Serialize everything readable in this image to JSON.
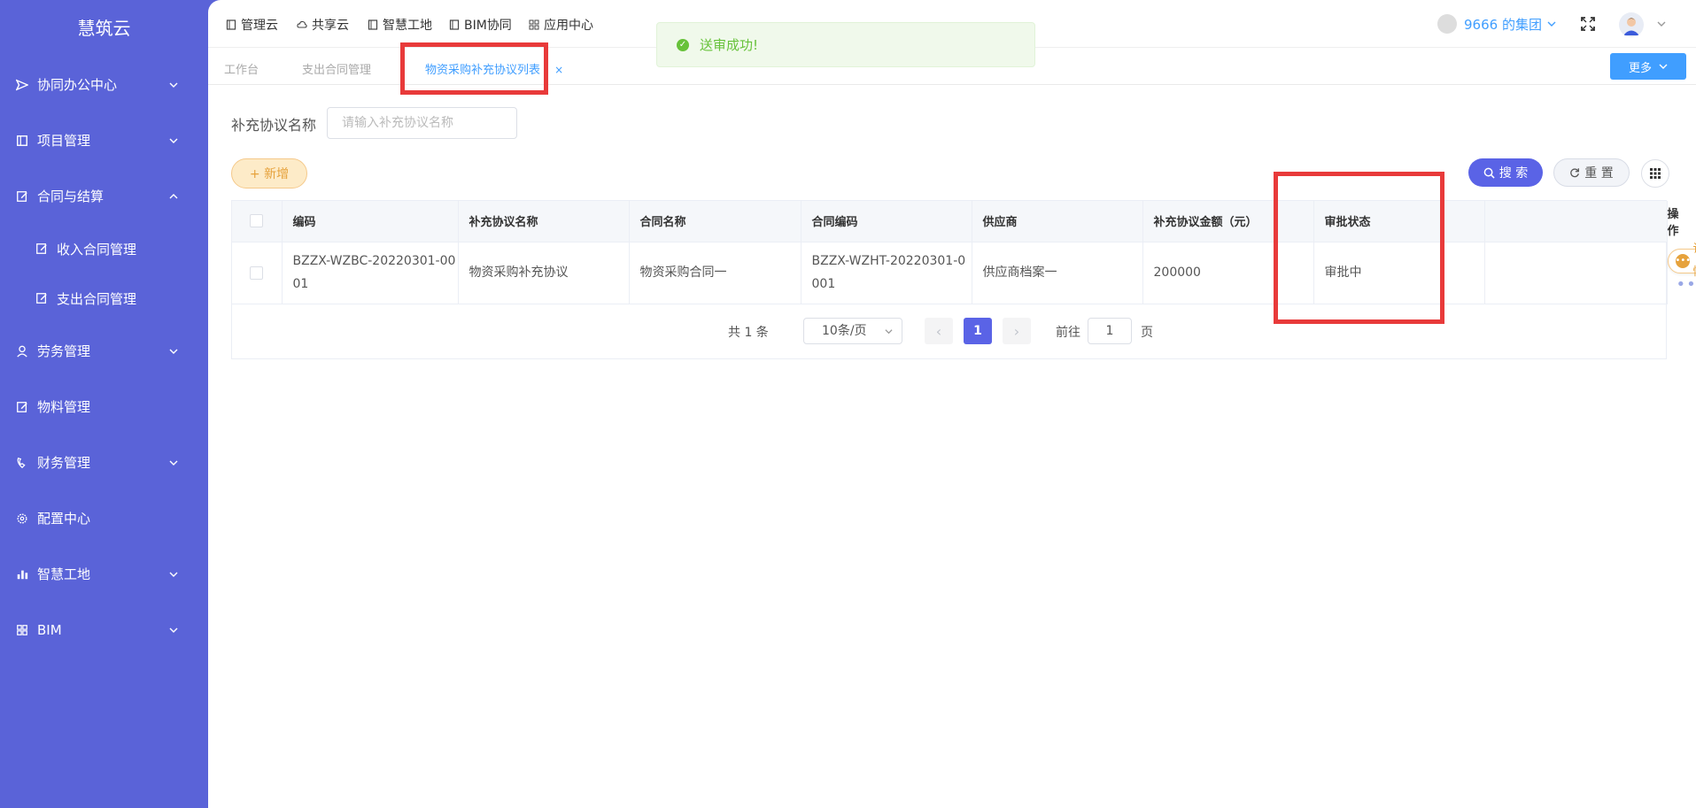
{
  "app": {
    "logo": "慧筑云"
  },
  "sidebar": {
    "items": [
      {
        "label": "协同办公中心",
        "icon": "send-icon",
        "expandable": true
      },
      {
        "label": "项目管理",
        "icon": "book-icon",
        "expandable": true
      },
      {
        "label": "合同与结算",
        "icon": "edit-icon",
        "expandable": true,
        "expanded": true,
        "children": [
          {
            "label": "收入合同管理",
            "icon": "edit-icon"
          },
          {
            "label": "支出合同管理",
            "icon": "edit-icon"
          }
        ]
      },
      {
        "label": "劳务管理",
        "icon": "worker-icon",
        "expandable": true
      },
      {
        "label": "物料管理",
        "icon": "edit-icon",
        "expandable": false
      },
      {
        "label": "财务管理",
        "icon": "phone-icon",
        "expandable": true
      },
      {
        "label": "配置中心",
        "icon": "gear-icon",
        "expandable": false
      },
      {
        "label": "智慧工地",
        "icon": "bar-chart-icon",
        "expandable": true
      },
      {
        "label": "BIM",
        "icon": "grid-icon",
        "expandable": true
      }
    ]
  },
  "topnav": {
    "items": [
      {
        "label": "管理云",
        "icon": "doc-icon"
      },
      {
        "label": "共享云",
        "icon": "cloud-icon"
      },
      {
        "label": "智慧工地",
        "icon": "doc-icon"
      },
      {
        "label": "BIM协同",
        "icon": "doc-icon"
      },
      {
        "label": "应用中心",
        "icon": "apps-icon"
      }
    ],
    "group": "9666 的集团"
  },
  "tabs": {
    "items": [
      {
        "label": "工作台",
        "active": false
      },
      {
        "label": "支出合同管理",
        "active": false
      },
      {
        "label": "物资采购补充协议列表",
        "active": true,
        "closable": true
      }
    ],
    "close_glyph": "×",
    "more_label": "更多"
  },
  "toast": {
    "message": "送审成功!",
    "color": "#67c23a"
  },
  "search": {
    "label": "补充协议名称",
    "placeholder": "请输入补充协议名称",
    "value": ""
  },
  "toolbar": {
    "add_label": "+ 新增",
    "search_label": "搜 索",
    "reset_label": "重 置"
  },
  "table": {
    "columns": [
      "编码",
      "补充协议名称",
      "合同名称",
      "合同编码",
      "供应商",
      "补充协议金额（元）",
      "审批状态",
      "",
      "操作"
    ],
    "rows": [
      {
        "code": "BZZX-WZBC-20220301-0001",
        "name": "物资采购补充协议",
        "contract_name": "物资采购合同一",
        "contract_code": "BZZX-WZHT-20220301-0001",
        "supplier": "供应商档案一",
        "amount": "200000",
        "status": "审批中",
        "detail_label": "详情"
      }
    ]
  },
  "pagination": {
    "total": "共 1 条",
    "page_size": "10条/页",
    "current": "1",
    "goto_prefix": "前往",
    "goto_value": "1",
    "goto_suffix": "页"
  },
  "colors": {
    "sidebar": "#5a63d8",
    "primary": "#409eff",
    "accent": "#5a63e6",
    "warning": "#e6a23c",
    "annotation": "#e83a3a"
  }
}
